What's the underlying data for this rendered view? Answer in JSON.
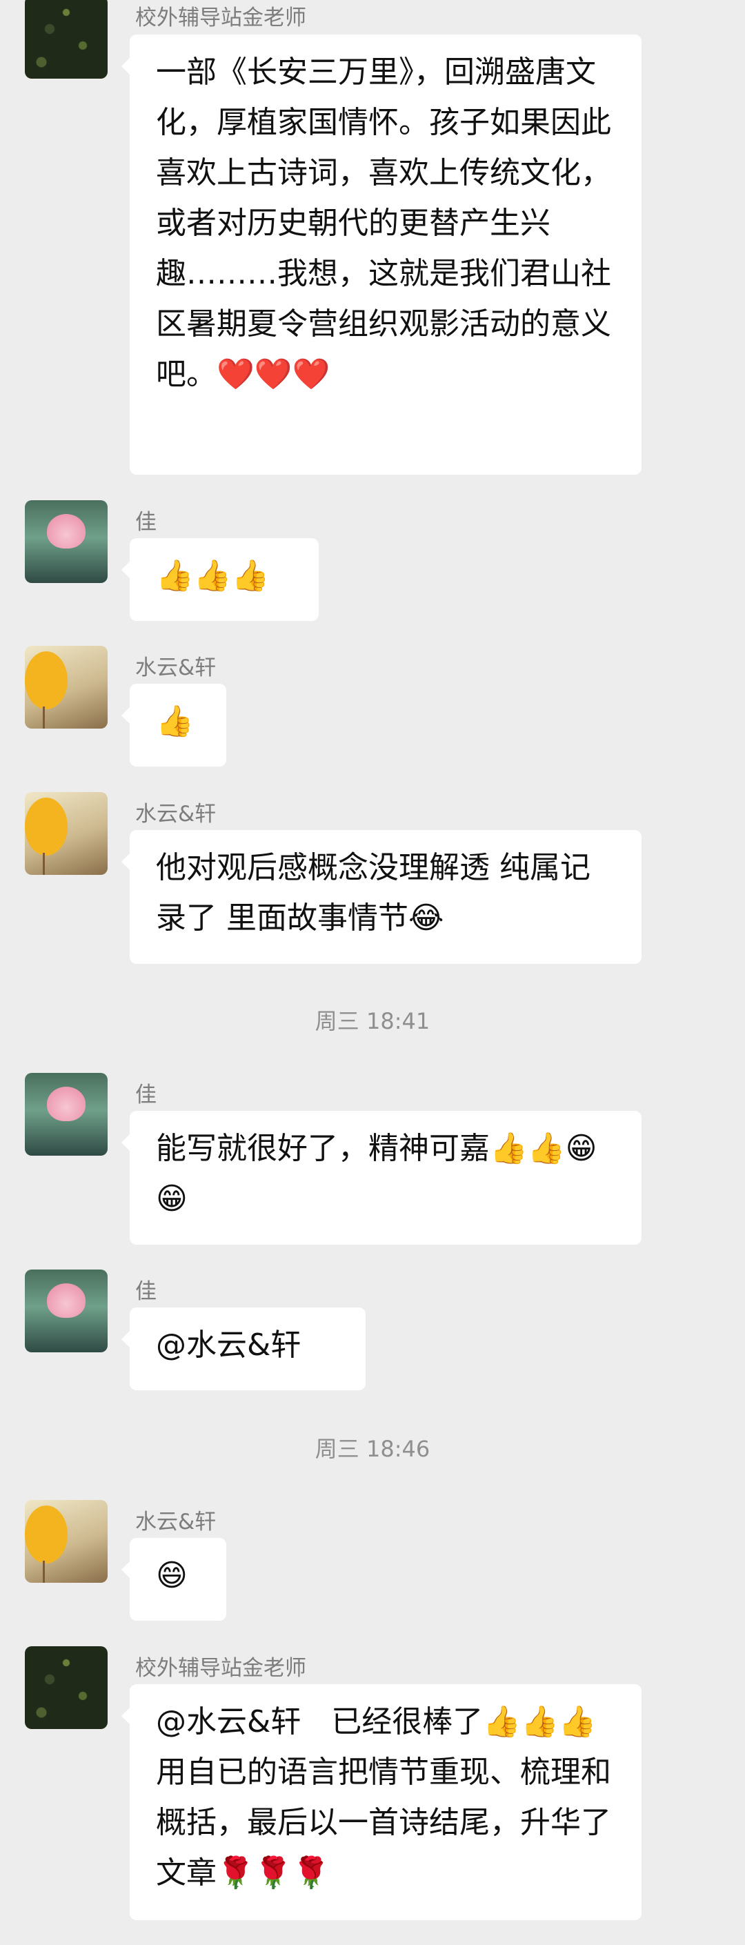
{
  "messages": [
    {
      "sender": "校外辅导站金老师",
      "text": "一部《长安三万里》，回溯盛唐文化，厚植家国情怀。孩子如果因此喜欢上古诗词，喜欢上传统文化，或者对历史朝代的更替产生兴趣………我想，这就是我们君山社区暑期夏令营组织观影活动的意义吧。❤️❤️❤️"
    },
    {
      "sender": "佳",
      "text": "👍👍👍"
    },
    {
      "sender": "水云&轩",
      "text": "👍"
    },
    {
      "sender": "水云&轩",
      "text": "他对观后感概念没理解透 纯属记录了 里面故事情节😂"
    },
    {
      "timestamp": "周三 18:41"
    },
    {
      "sender": "佳",
      "text": "能写就很好了，精神可嘉👍👍😁😁"
    },
    {
      "sender": "佳",
      "text": "@水云&轩"
    },
    {
      "timestamp": "周三 18:46"
    },
    {
      "sender": "水云&轩",
      "text": "😄"
    },
    {
      "sender": "校外辅导站金老师",
      "text": "@水云&轩　已经很棒了👍👍👍用自已的语言把情节重现、梳理和概括，最后以一首诗结尾，升华了文章🌹🌹🌹"
    }
  ]
}
